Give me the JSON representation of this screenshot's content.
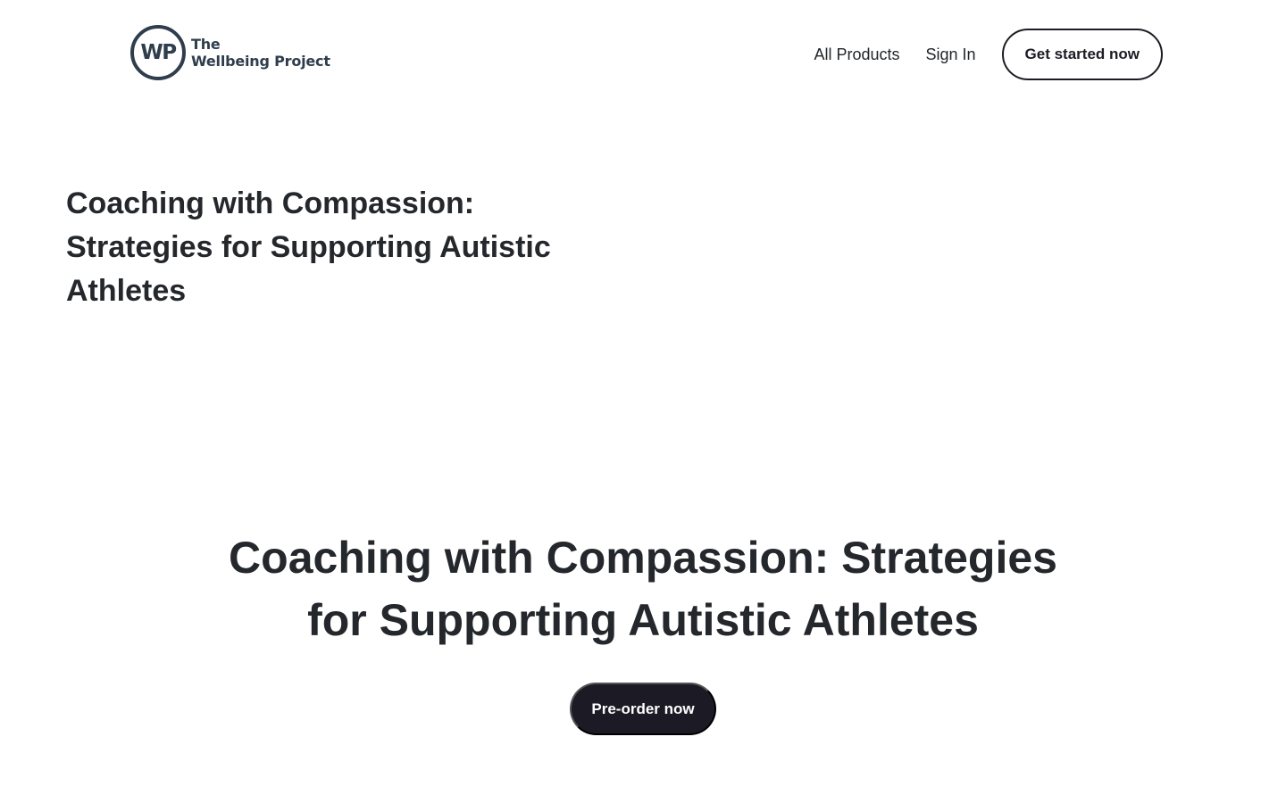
{
  "header": {
    "logo": {
      "mark": "WP",
      "line1": "The",
      "line2": "Wellbeing Project"
    },
    "nav": {
      "all_products": "All Products",
      "sign_in": "Sign In",
      "get_started": "Get started now"
    }
  },
  "page": {
    "small_title": "Coaching with Compassion: Strategies for Supporting Autistic Athletes",
    "hero_title": "Coaching with Compassion: Strategies for Supporting Autistic Athletes",
    "preorder_label": "Pre-order now"
  },
  "colors": {
    "text": "#24272b",
    "logo": "#2f3d4d",
    "button_dark": "#1c1b25",
    "background": "#ffffff"
  }
}
